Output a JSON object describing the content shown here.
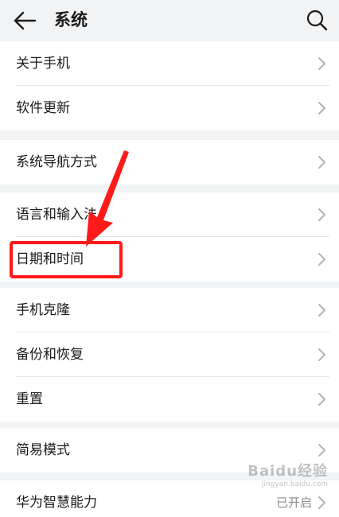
{
  "header": {
    "title": "系统"
  },
  "groups": [
    {
      "items": [
        {
          "label": "关于手机"
        },
        {
          "label": "软件更新"
        }
      ]
    },
    {
      "items": [
        {
          "label": "系统导航方式"
        }
      ]
    },
    {
      "items": [
        {
          "label": "语言和输入法"
        },
        {
          "label": "日期和时间"
        }
      ]
    },
    {
      "items": [
        {
          "label": "手机克隆"
        },
        {
          "label": "备份和恢复"
        },
        {
          "label": "重置"
        }
      ]
    },
    {
      "items": [
        {
          "label": "简易模式"
        }
      ]
    },
    {
      "items": [
        {
          "label": "华为智慧能力",
          "status": "已开启"
        }
      ]
    }
  ],
  "watermark": {
    "main": "Baidu经验",
    "sub": "jingyan.baidu.com"
  },
  "colors": {
    "background": "#f1f3f5",
    "annotation": "#ff1a1a"
  }
}
